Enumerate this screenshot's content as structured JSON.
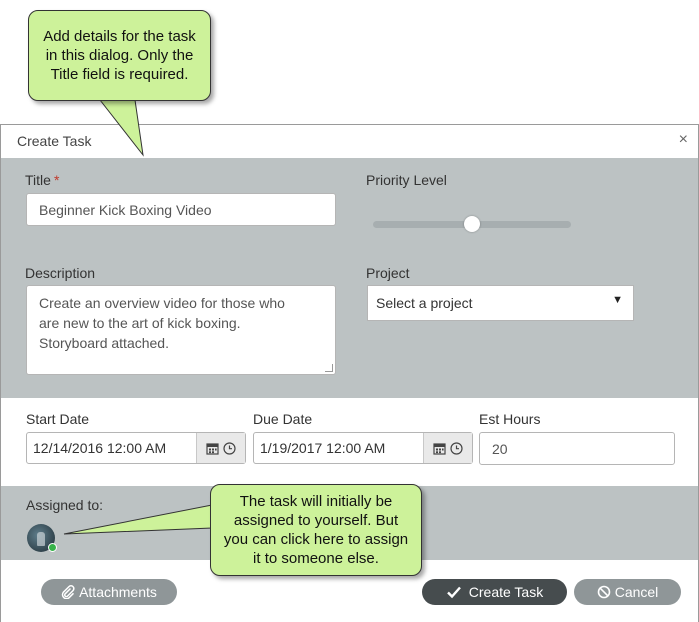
{
  "dialog": {
    "title": "Create Task",
    "close_glyph": "×"
  },
  "form": {
    "title_label": "Title",
    "required_marker": "*",
    "title_value": "Beginner Kick Boxing Video",
    "priority_label": "Priority Level",
    "priority_value": 0.5,
    "description_label": "Description",
    "description_lines": [
      "Create an overview video for those who",
      "are new to the art of kick boxing.",
      "Storyboard attached."
    ],
    "project_label": "Project",
    "project_selected": "Select a project",
    "start_label": "Start Date",
    "start_value": "12/14/2016 12:00 AM",
    "due_label": "Due Date",
    "due_value": "1/19/2017 12:00 AM",
    "hours_label": "Est Hours",
    "hours_value": "20",
    "assigned_label": "Assigned to:"
  },
  "footer": {
    "attachments_label": "Attachments",
    "create_label": "Create Task",
    "cancel_label": "Cancel"
  },
  "callouts": {
    "top": [
      "Add details for the task",
      "in this dialog. Only the",
      "Title field is required."
    ],
    "bottom": [
      "The task will initially be",
      "assigned to yourself. But",
      "you can click here to assign",
      "it to someone else."
    ]
  },
  "colors": {
    "section_gray": "#bcc2c3",
    "callout_green": "#cdf29a",
    "button_dark": "#464c4e",
    "button_gray": "#8f9698",
    "required_red": "#c0392b",
    "status_green": "#37b34a"
  },
  "icons": {
    "calendar": "calendar-icon",
    "clock": "clock-icon",
    "paperclip": "paperclip-icon",
    "check": "check-icon",
    "cancel": "cancel-icon",
    "dropdown": "chevron-down-icon"
  }
}
